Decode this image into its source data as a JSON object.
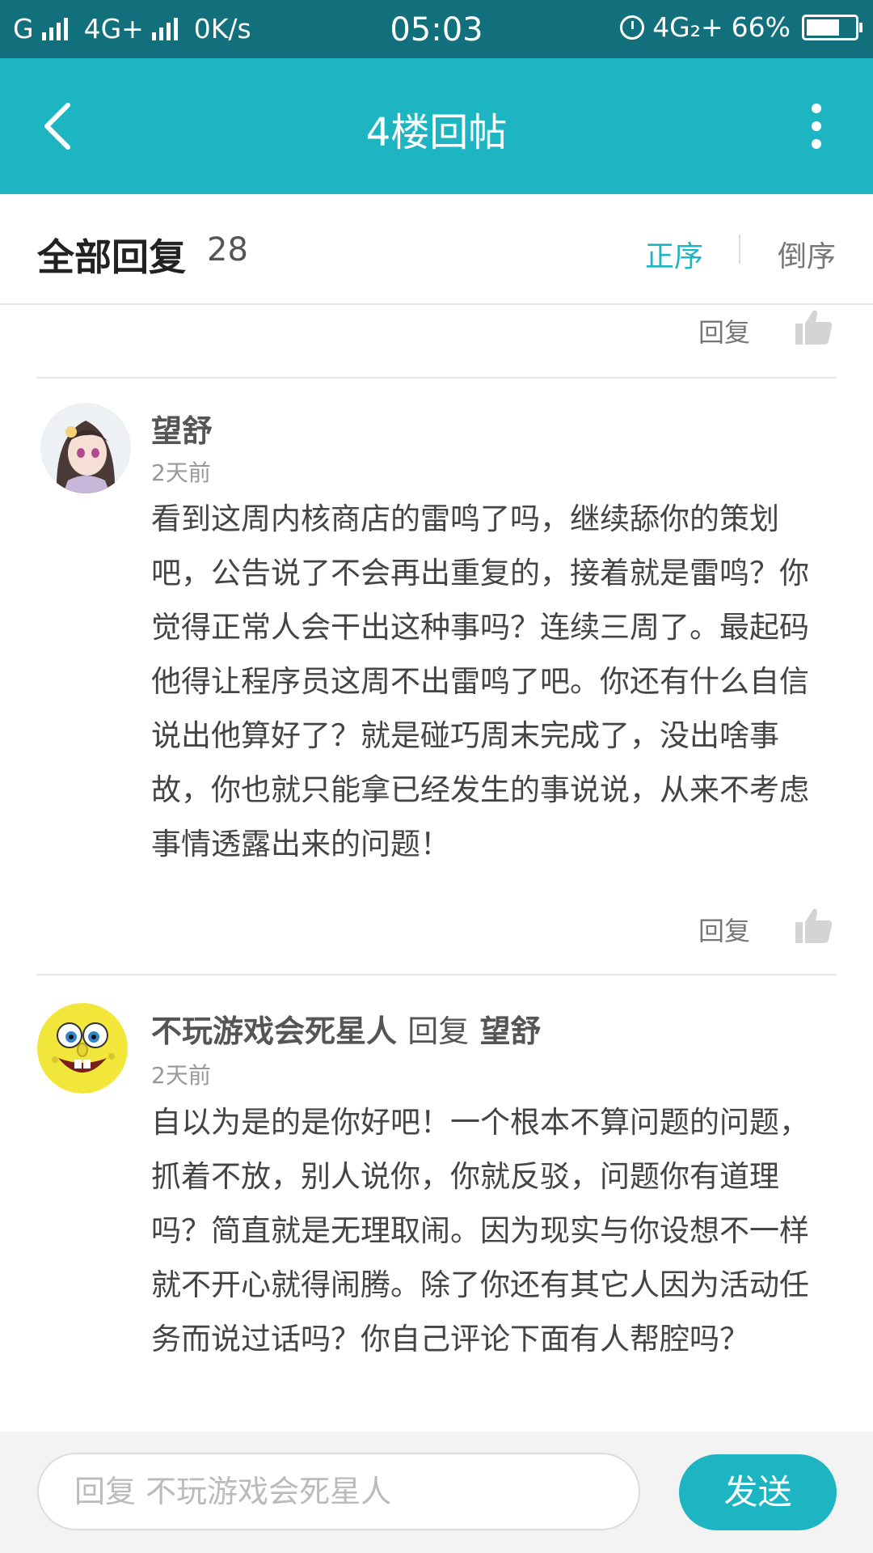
{
  "status": {
    "carrier1": "G",
    "carrier2": "4G+",
    "speed": "0K/s",
    "time": "05:03",
    "network": "4G₂+",
    "battery": "66%"
  },
  "appbar": {
    "title": "4楼回帖"
  },
  "header": {
    "label": "全部回复",
    "count": "28",
    "sort_asc": "正序",
    "sort_desc": "倒序"
  },
  "actions": {
    "reply": "回复"
  },
  "comments": [
    {
      "user": "望舒",
      "time": "2天前",
      "text": "看到这周内核商店的雷鸣了吗，继续舔你的策划吧，公告说了不会再出重复的，接着就是雷鸣？你觉得正常人会干出这种事吗？连续三周了。最起码他得让程序员这周不出雷鸣了吧。你还有什么自信说出他算好了？就是碰巧周末完成了，没出啥事故，你也就只能拿已经发生的事说说，从来不考虑事情透露出来的问题！"
    },
    {
      "user": "不玩游戏会死星人",
      "reply_word": "回复",
      "reply_to": "望舒",
      "time": "2天前",
      "text": "自以为是的是你好吧！一个根本不算问题的问题，抓着不放，别人说你，你就反驳，问题你有道理吗？简直就是无理取闹。因为现实与你设想不一样就不开心就得闹腾。除了你还有其它人因为活动任务而说过话吗？你自己评论下面有人帮腔吗？"
    }
  ],
  "composer": {
    "placeholder": "回复 不玩游戏会死星人",
    "send": "发送"
  },
  "colors": {
    "accent": "#1eb5c2",
    "statusbar": "#12707d"
  }
}
